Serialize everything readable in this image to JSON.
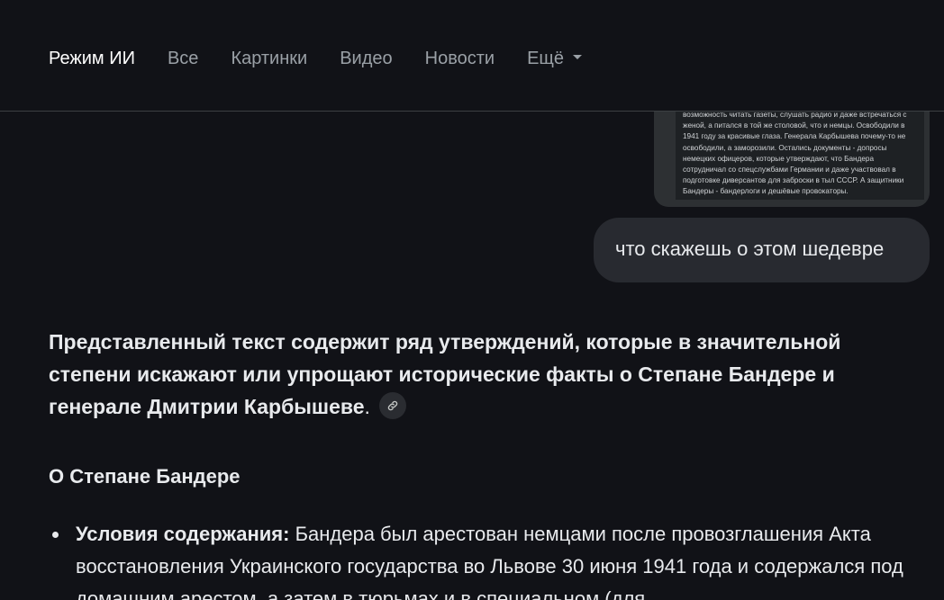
{
  "nav": {
    "tabs": [
      "Режим ИИ",
      "Все",
      "Картинки",
      "Видео",
      "Новости",
      "Ещё"
    ]
  },
  "attached_image": {
    "text": "возможность читать газеты, слушать радио и даже встречаться с женой, а питался в той же столовой, что и немцы. Освободили в 1941 году за красивые глаза. Генерала Карбышева почему-то не освободили, а заморозили. Остались документы - допросы немецких офицеров, которые утверждают, что Бандера сотрудничал со спецслужбами Германии и даже участвовал в подготовке диверсантов для заброски в тыл СССР. А защитники Бандеры - бандерлоги и дешёвые провокаторы."
  },
  "user_message": "что скажешь о этом шедевре",
  "answer": {
    "intro": "Представленный текст содержит ряд утверждений, которые в значительной степени искажают или упрощают исторические факты о Степане Бандере и генерале Дмитрии Карбышеве",
    "intro_end": "."
  },
  "section": {
    "title": "О Степане Бандере",
    "bullets": [
      {
        "label": "Условия содержания:",
        "text": " Бандера был арестован немцами после провозглашения Акта восстановления Украинского государства во Львове 30 июня 1941 года и содержался под домашним арестом, а затем в тюрьмах и в специальном (для"
      }
    ]
  },
  "colors": {
    "background": "#111217",
    "bubble": "#282a30",
    "text": "#e8eaed",
    "muted": "#9aa0a6"
  }
}
